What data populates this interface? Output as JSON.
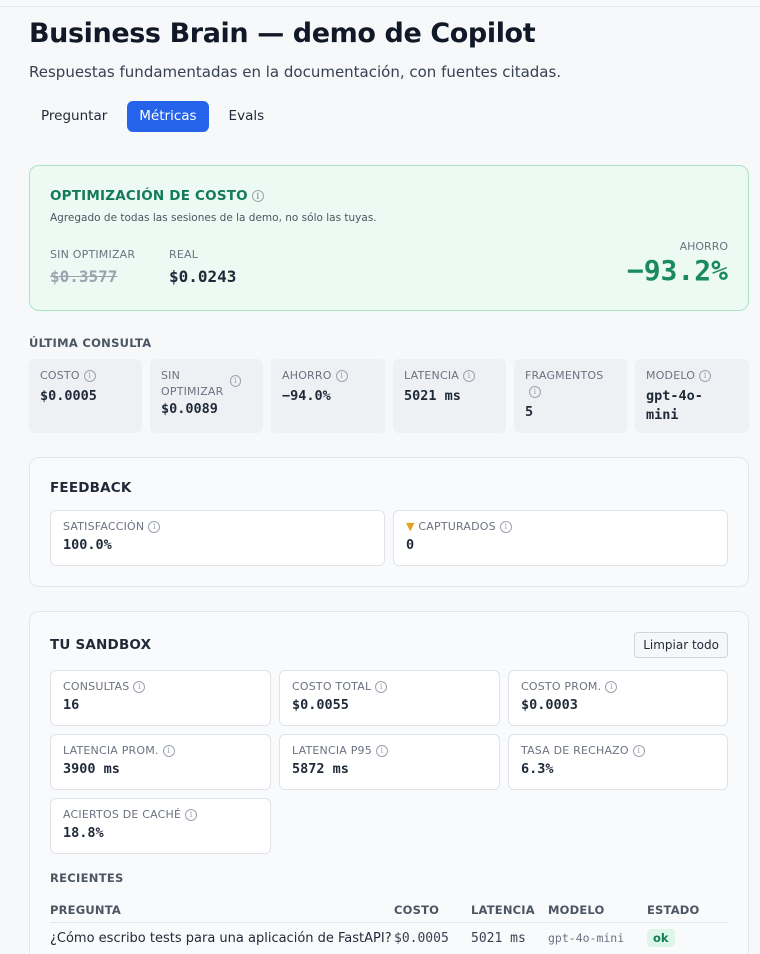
{
  "header": {
    "title": "Business Brain — demo de Copilot",
    "subtitle": "Respuestas fundamentadas en la documentación, con fuentes citadas."
  },
  "tabs": [
    {
      "label": "Preguntar",
      "active": false
    },
    {
      "label": "Métricas",
      "active": true
    },
    {
      "label": "Evals",
      "active": false
    }
  ],
  "cost_optimization": {
    "title": "OPTIMIZACIÓN DE COSTO",
    "description": "Agregado de todas las sesiones de la demo, no sólo las tuyas.",
    "unoptimized_label": "SIN OPTIMIZAR",
    "unoptimized_value": "$0.3577",
    "real_label": "REAL",
    "real_value": "$0.0243",
    "savings_label": "AHORRO",
    "savings_value": "−93.2%"
  },
  "last_query": {
    "section_label": "ÚLTIMA CONSULTA",
    "items": [
      {
        "label": "COSTO",
        "value": "$0.0005"
      },
      {
        "label": "SIN OPTIMIZAR",
        "value": "$0.0089"
      },
      {
        "label": "AHORRO",
        "value": "−94.0%"
      },
      {
        "label": "LATENCIA",
        "value": "5021 ms"
      },
      {
        "label": "FRAGMENTOS",
        "value": "5"
      },
      {
        "label": "MODELO",
        "value": "gpt-4o-mini"
      }
    ]
  },
  "feedback": {
    "title": "FEEDBACK",
    "satisfaction_label": "SATISFACCIÓN",
    "satisfaction_value": "100.0%",
    "captured_icon": "thumbs-down-icon",
    "captured_label": "CAPTURADOS",
    "captured_value": "0"
  },
  "sandbox": {
    "title": "TU SANDBOX",
    "clear_button": "Limpiar todo",
    "stats": [
      {
        "label": "CONSULTAS",
        "value": "16"
      },
      {
        "label": "COSTO TOTAL",
        "value": "$0.0055"
      },
      {
        "label": "COSTO PROM.",
        "value": "$0.0003"
      },
      {
        "label": "LATENCIA PROM.",
        "value": "3900 ms"
      },
      {
        "label": "LATENCIA P95",
        "value": "5872 ms"
      },
      {
        "label": "TASA DE RECHAZO",
        "value": "6.3%"
      },
      {
        "label": "ACIERTOS DE CACHÉ",
        "value": "18.8%"
      }
    ],
    "recent_label": "RECIENTES",
    "table": {
      "columns": [
        "PREGUNTA",
        "COSTO",
        "LATENCIA",
        "MODELO",
        "ESTADO"
      ],
      "rows": [
        {
          "question": "¿Cómo escribo tests para una aplicación de FastAPI?",
          "cost": "$0.0005",
          "latency": "5021 ms",
          "model": "gpt-4o-mini",
          "status": "ok"
        }
      ]
    }
  },
  "colors": {
    "accent": "#2563eb",
    "savings_green": "#1a8a63",
    "cost_card_bg": "#ecfaf3"
  }
}
